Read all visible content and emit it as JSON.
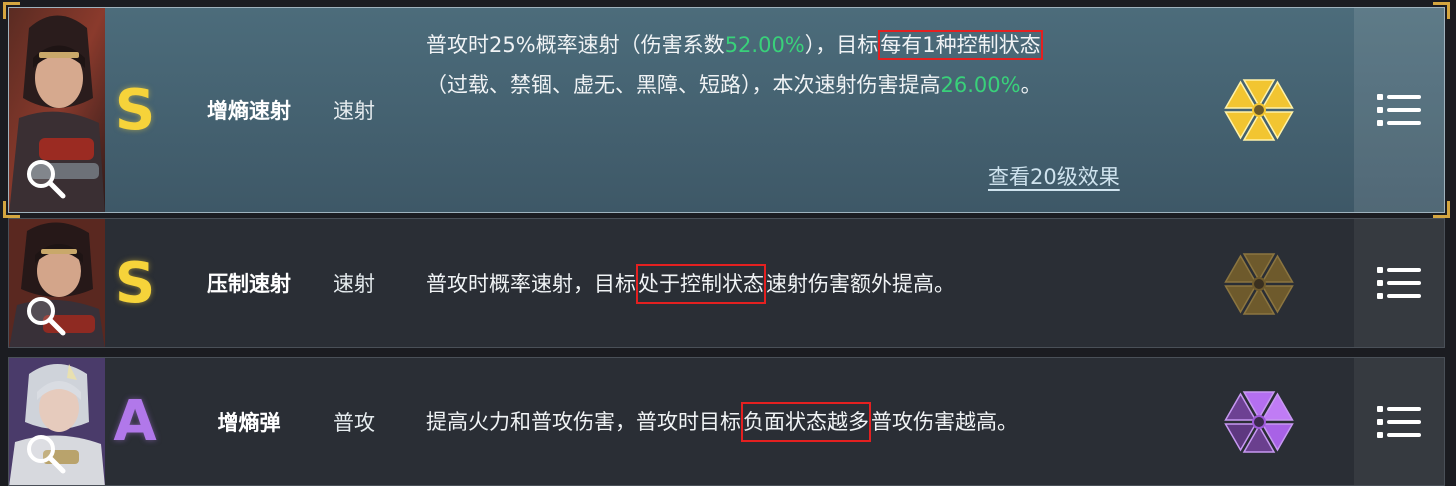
{
  "colors": {
    "grade_s": "#f6d33a",
    "grade_a": "#b178ea",
    "value_green": "#39d17a",
    "highlight_box": "#e42020",
    "active_row_bg": "#4c6c7b",
    "row_bg": "#2a2e35"
  },
  "rows": [
    {
      "grade": "S",
      "name": "增熵速射",
      "type": "速射",
      "desc": {
        "line1_a": "普攻时25%概率速射（伤害系数",
        "line1_value": "52.00%",
        "line1_b": "），目标",
        "line1_hl": "每有1种控制状态",
        "line2_a": "（过载、禁锢、虚无、黑障、短路），本次速射伤害提高",
        "line2_value": "26.00%",
        "line2_b": "。"
      },
      "link": "查看20级效果",
      "badge_icon": "hex-badge-gold-icon",
      "menu_icon": "list-menu-icon"
    },
    {
      "grade": "S",
      "name": "压制速射",
      "type": "速射",
      "desc": {
        "a": "普攻时概率速射，目标",
        "hl": "处于控制状态",
        "b": "速射伤害额外提高。"
      },
      "badge_icon": "hex-badge-dim-gold-icon",
      "menu_icon": "list-menu-icon"
    },
    {
      "grade": "A",
      "name": "增熵弹",
      "type": "普攻",
      "desc": {
        "a": "提高火力和普攻伤害，普攻时目标",
        "hl": "负面状态越多",
        "b": "普攻伤害越高。"
      },
      "badge_icon": "hex-badge-purple-icon",
      "menu_icon": "list-menu-icon"
    }
  ]
}
